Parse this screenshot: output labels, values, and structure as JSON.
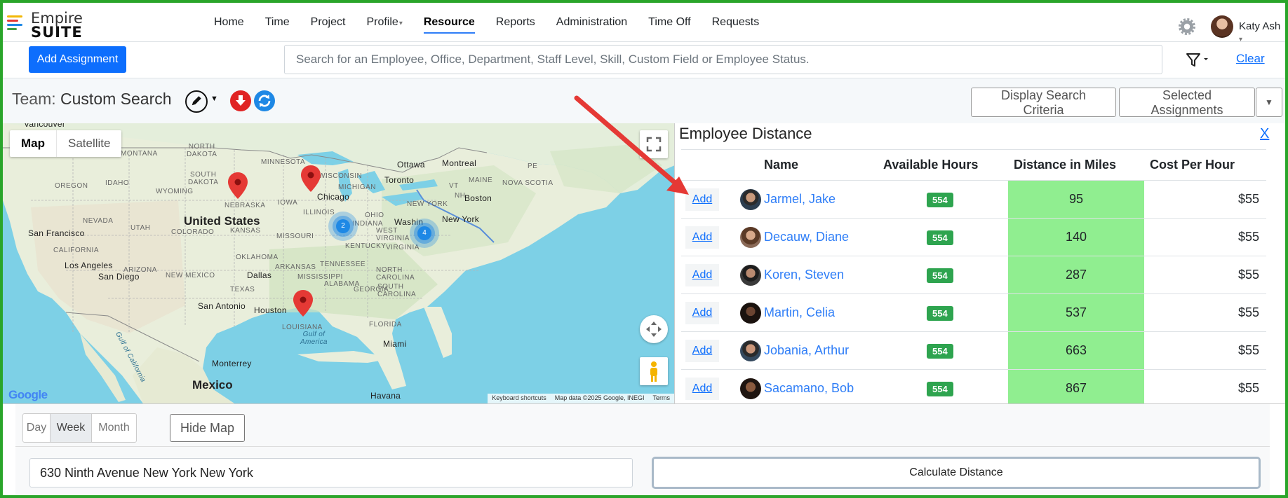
{
  "header": {
    "logo_line1": "Empire",
    "logo_line2": "SUITE",
    "nav": [
      "Home",
      "Time",
      "Project",
      "Profile",
      "Resource",
      "Reports",
      "Administration",
      "Time Off",
      "Requests"
    ],
    "active_nav": "Resource",
    "user_name": "Katy Ash"
  },
  "toolbar": {
    "add_assignment": "Add Assignment",
    "search_placeholder": "Search for an Employee, Office, Department, Staff Level, Skill, Custom Field or Employee Status.",
    "clear": "Clear"
  },
  "team": {
    "label": "Team:",
    "value": "Custom Search",
    "display_criteria": "Display Search Criteria",
    "selected_assignments": "Selected Assignments"
  },
  "map": {
    "tab_map": "Map",
    "tab_satellite": "Satellite",
    "country_us": "United States",
    "country_mx": "Mexico",
    "cluster_a": "2",
    "cluster_b": "4",
    "google": "Google",
    "attrib_shortcuts": "Keyboard shortcuts",
    "attrib_data": "Map data ©2025 Google, INEGI",
    "attrib_terms": "Terms",
    "labels": {
      "vancouver": "Vancouver",
      "north_dakota": "NORTH\nDAKOTA",
      "minnesota": "MINNESOTA",
      "montana": "MONTANA",
      "south_dakota": "SOUTH\nDAKOTA",
      "wisconsin": "WISCONSIN",
      "michigan": "MICHIGAN",
      "oregon": "OREGON",
      "idaho": "IDAHO",
      "wyoming": "WYOMING",
      "nebraska": "NEBRASKA",
      "iowa": "IOWA",
      "nevada": "NEVADA",
      "utah": "UTAH",
      "colorado": "COLORADO",
      "kansas": "KANSAS",
      "missouri": "MISSOURI",
      "illinois": "ILLINOIS",
      "indiana": "INDIANA",
      "ohio": "OHIO",
      "california": "CALIFORNIA",
      "arizona": "ARIZONA",
      "new_mexico": "NEW MEXICO",
      "oklahoma": "OKLAHOMA",
      "arkansas": "ARKANSAS",
      "tennessee": "TENNESSEE",
      "mississippi": "MISSISSIPPI",
      "alabama": "ALABAMA",
      "georgia": "GEORGIA",
      "texas": "TEXAS",
      "louisiana": "LOUISIANA",
      "florida": "FLORIDA",
      "kentucky": "KENTUCKY",
      "west_virginia": "WEST\nVIRGINIA",
      "virginia": "VIRGINIA",
      "north_carolina": "NORTH\nCAROLINA",
      "south_carolina": "SOUTH\nCAROLINA",
      "new_york": "NEW YORK",
      "maine": "MAINE",
      "nova_scotia": "NOVA SCOTIA",
      "pe": "PE",
      "vt": "VT",
      "nh": "NH",
      "ottawa": "Ottawa",
      "montreal": "Montreal",
      "toronto": "Toronto",
      "boston": "Boston",
      "chicago": "Chicago",
      "washington": "Washin",
      "new_york_city": "New York",
      "san_francisco": "San Francisco",
      "los_angeles": "Los Angeles",
      "san_diego": "San Diego",
      "dallas": "Dallas",
      "san_antonio": "San Antonio",
      "houston": "Houston",
      "monterrey": "Monterrey",
      "miami": "Miami",
      "havana": "Havana",
      "gulf_of_mexico": "Gulf of\nAmerica",
      "gulf_of_california": "Gulf of California"
    }
  },
  "distance": {
    "title": "Employee Distance",
    "close": "X",
    "columns": [
      "",
      "",
      "Name",
      "Available Hours",
      "Distance in Miles",
      "Cost Per Hour"
    ],
    "add_label": "Add",
    "rows": [
      {
        "name": "Jarmel, Jake",
        "hours": "554",
        "miles": "95",
        "cost": "$55"
      },
      {
        "name": "Decauw, Diane",
        "hours": "554",
        "miles": "140",
        "cost": "$55"
      },
      {
        "name": "Koren, Steven",
        "hours": "554",
        "miles": "287",
        "cost": "$55"
      },
      {
        "name": "Martin, Celia",
        "hours": "554",
        "miles": "537",
        "cost": "$55"
      },
      {
        "name": "Jobania, Arthur",
        "hours": "554",
        "miles": "663",
        "cost": "$55"
      },
      {
        "name": "Sacamano, Bob",
        "hours": "554",
        "miles": "867",
        "cost": "$55"
      }
    ]
  },
  "bottom": {
    "day": "Day",
    "week": "Week",
    "month": "Month",
    "hide_map": "Hide Map",
    "address": "630 Ninth Avenue New York New York",
    "calculate": "Calculate Distance"
  },
  "colors": {
    "accent": "#0d6efd",
    "distance_highlight": "#90ee90",
    "badge": "#2ea44f",
    "frame": "#2aa52a",
    "annotation_arrow": "#e53935"
  }
}
